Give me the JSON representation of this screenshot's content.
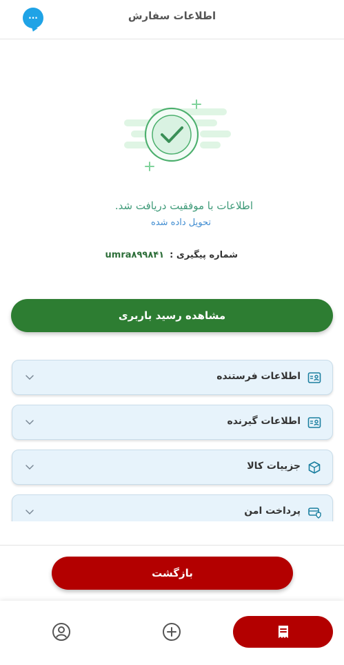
{
  "header": {
    "title": "اطلاعات سفارش",
    "chat_icon_text": "···"
  },
  "success": {
    "message": "اطلاعات با موفقیت دریافت شد.",
    "status": "تحویل داده شده"
  },
  "tracking": {
    "label": "شماره پیگیری :",
    "value": "umra۸۹۹۸۴۱"
  },
  "actions": {
    "view_receipt_label": "مشاهده رسید باربری",
    "back_label": "بازگشت"
  },
  "sections": [
    {
      "label": "اطلاعات فرستنده",
      "icon": "id-card-icon"
    },
    {
      "label": "اطلاعات گیرنده",
      "icon": "id-card-icon"
    },
    {
      "label": "جزییات کالا",
      "icon": "box-icon"
    },
    {
      "label": "پرداخت امن",
      "icon": "secure-payment-icon"
    }
  ],
  "bottom_nav": [
    {
      "name": "orders",
      "icon": "receipt-icon",
      "active": true
    },
    {
      "name": "add",
      "icon": "plus-circle-icon",
      "active": false
    },
    {
      "name": "profile",
      "icon": "user-icon",
      "active": false
    }
  ],
  "colors": {
    "primary_green": "#2d7d32",
    "accent_red": "#b30000",
    "success_text": "#3e9a78",
    "status_blue": "#3f8cd1",
    "chat_blue": "#1fa3e6",
    "section_bg": "#e7f3fb"
  }
}
